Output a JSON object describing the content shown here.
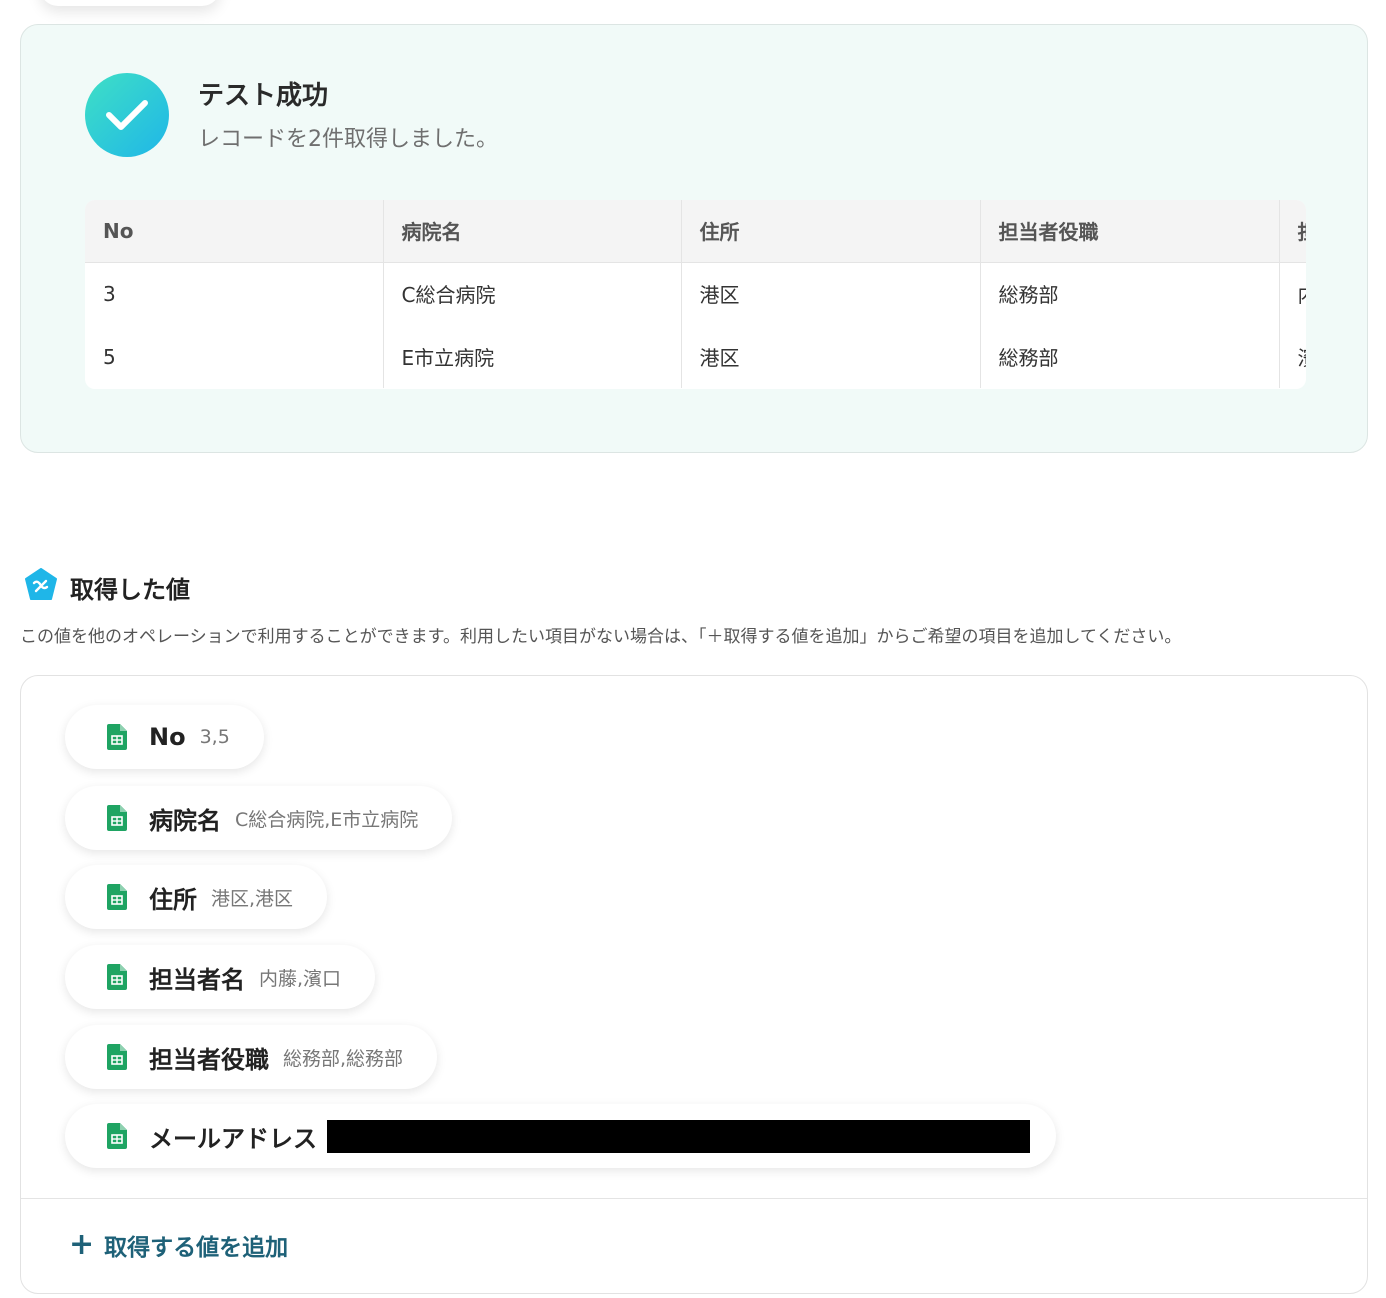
{
  "test_result": {
    "title": "テスト成功",
    "subtitle": "レコードを2件取得しました。"
  },
  "records_table": {
    "columns": [
      "No",
      "病院名",
      "住所",
      "担当者役職",
      "担"
    ],
    "rows": [
      [
        "3",
        "C総合病院",
        "港区",
        "総務部",
        "内"
      ],
      [
        "5",
        "E市立病院",
        "港区",
        "総務部",
        "濱"
      ]
    ]
  },
  "retrieved_values": {
    "title": "取得した値",
    "description": "この値を他のオペレーションで利用することができます。利用したい項目がない場合は、「＋取得する値を追加」からご希望の項目を追加してください。",
    "items": [
      {
        "label": "No",
        "value": "3,5"
      },
      {
        "label": "病院名",
        "value": "C総合病院,E市立病院"
      },
      {
        "label": "住所",
        "value": "港区,港区"
      },
      {
        "label": "担当者名",
        "value": "内藤,濱口"
      },
      {
        "label": "担当者役職",
        "value": "総務部,総務部"
      },
      {
        "label": "メールアドレス",
        "value": ""
      }
    ],
    "add_button_label": "取得する値を追加"
  },
  "icons": {
    "success": "check-icon",
    "section": "variable-badge-icon",
    "item": "spreadsheet-icon",
    "add": "plus-icon"
  },
  "colors": {
    "accent": "#1e6178",
    "success_gradient_start": "#3fe0c5",
    "success_gradient_end": "#1fb6e8",
    "sheet_green": "#1fa463"
  }
}
